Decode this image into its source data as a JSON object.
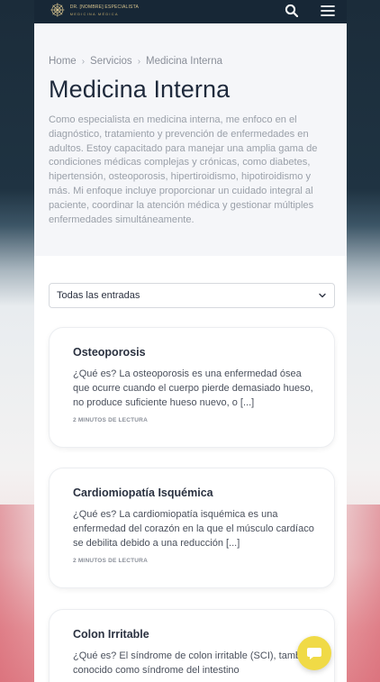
{
  "header": {
    "logo_line1": "DR. [NOMBRE] ESPECIALISTA",
    "logo_line2": "MEDICINA MÉDICA",
    "search_icon": "search-icon",
    "menu_icon": "hamburger-menu-icon"
  },
  "breadcrumb": {
    "items": [
      "Home",
      "Servicios",
      "Medicina Interna"
    ],
    "separator": "›"
  },
  "page": {
    "title": "Medicina Interna",
    "intro": "Como especialista en medicina interna, me enfoco en el diagnóstico, tratamiento y prevención de enfermedades en adultos. Estoy capacitado para manejar una amplia gama de condiciones médicas complejas y crónicas, como diabetes, hipertensión, osteoporosis, hipertiroidismo, hipotiroidismo y más. Mi enfoque incluye proporcionar un cuidado integral al paciente, coordinar la atención médica y gestionar múltiples enfermedades simultáneamente."
  },
  "filter": {
    "selected": "Todas las entradas"
  },
  "posts": [
    {
      "title": "Osteoporosis",
      "excerpt": "¿Qué es? La osteoporosis  es una enfermedad ósea que ocurre cuando el cuerpo pierde demasiado hueso, no produce suficiente hueso nuevo, o [...]",
      "meta": "2 MINUTOS DE LECTURA"
    },
    {
      "title": "Cardiomiopatía Isquémica",
      "excerpt": "¿Qué es? La cardiomiopatía isquémica es una enfermedad del corazón en la que el músculo cardíaco se debilita debido a una reducción [...]",
      "meta": "2 MINUTOS DE LECTURA"
    },
    {
      "title": "Colon Irritable",
      "excerpt": "¿Qué es? El síndrome de colon irritable (SCI), también conocido como síndrome del intestino",
      "meta": ""
    }
  ],
  "colors": {
    "header_bg": "#172736",
    "accent_gold": "#d9c58f",
    "chat_yellow": "#f0da46",
    "title_text": "#1f2a3c"
  }
}
